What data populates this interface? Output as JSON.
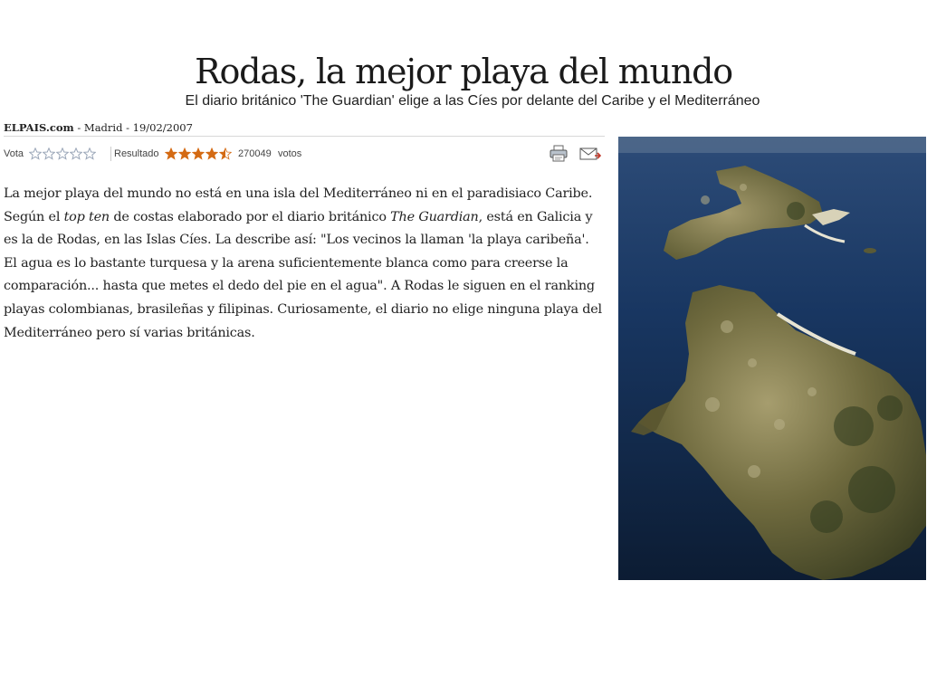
{
  "article": {
    "headline": "Rodas, la mejor playa del mundo",
    "subheadline": "El diario británico 'The Guardian' elige a las Cíes por delante del Caribe y el Mediterráneo",
    "byline": {
      "source": "ELPAIS.com",
      "separator1": " - ",
      "location": "Madrid",
      "separator2": " - ",
      "date": "19/02/2007"
    },
    "body": {
      "part1": "La mejor playa del mundo no está en una isla del Mediterráneo ni en el paradisiaco Caribe. Según el ",
      "em1": "top ten",
      "part2": " de costas elaborado por el diario británico ",
      "em2": "The Guardian",
      "part3": ", está en Galicia y es la de Rodas, en las Islas Cíes. La describe así: \"Los vecinos la llaman 'la playa caribeña'. El agua es lo bastante turquesa y la arena suficientemente blanca como para creerse la comparación... hasta que metes el dedo del pie en el agua\". A Rodas le siguen en el ranking playas colombianas, brasileñas y filipinas. Curiosamente, el diario no elige ninguna playa del Mediterráneo pero sí varias británicas."
    }
  },
  "voting": {
    "vote_label": "Vota",
    "user_stars": 5,
    "result_label": "Resultado",
    "rating": 4.5,
    "rating_max": 5,
    "votes_count": "270049",
    "votes_unit": "votos"
  },
  "tools": {
    "print_icon": "printer-icon",
    "email_icon": "envelope-icon"
  },
  "colors": {
    "star_filled": "#d46a13",
    "star_empty_stroke": "#9aa6b8",
    "sea": "#172f55"
  }
}
